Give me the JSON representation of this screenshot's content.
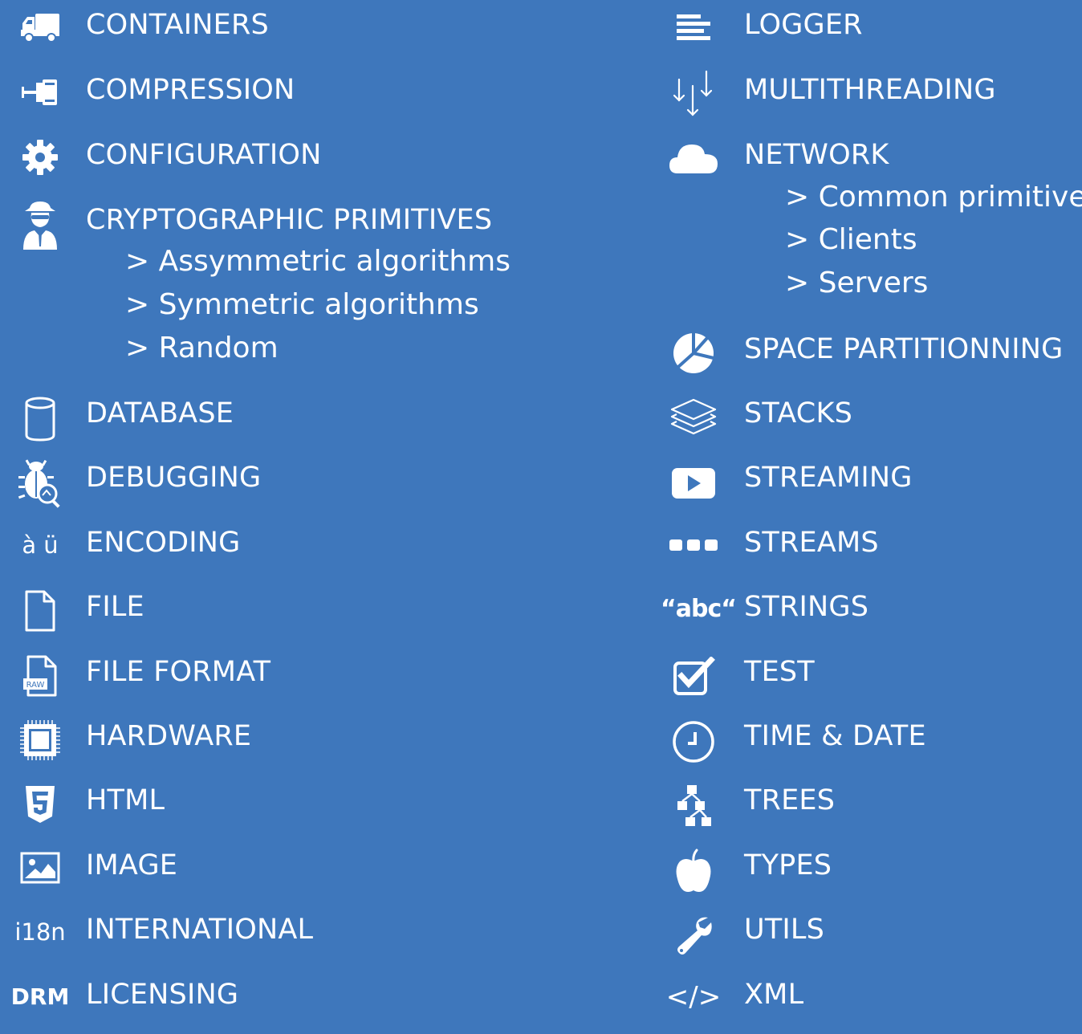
{
  "left": {
    "containers": "CONTAINERS",
    "compression": "COMPRESSION",
    "configuration": "CONFIGURATION",
    "crypto": "CRYPTOGRAPHIC PRIMITIVES",
    "crypto_sub": [
      "> Assymmetric algorithms",
      "> Symmetric algorithms",
      "> Random"
    ],
    "database": "DATABASE",
    "debugging": "DEBUGGING",
    "encoding": "ENCODING",
    "encoding_icon": "à ü",
    "file": "FILE",
    "file_format": "FILE FORMAT",
    "file_format_icon": "RAW",
    "hardware": "HARDWARE",
    "html": "HTML",
    "image": "IMAGE",
    "international": "INTERNATIONAL",
    "international_icon": "i18n",
    "licensing": "LICENSING",
    "licensing_icon": "DRM"
  },
  "right": {
    "logger": "LOGGER",
    "multithreading": "MULTITHREADING",
    "network": "NETWORK",
    "network_sub": [
      "> Common primitives",
      "> Clients",
      "> Servers"
    ],
    "space": "SPACE PARTITIONNING",
    "stacks": "STACKS",
    "streaming": "STREAMING",
    "streams": "STREAMS",
    "strings": "STRINGS",
    "strings_icon": "“abc“",
    "test": "TEST",
    "time": "TIME & DATE",
    "trees": "TREES",
    "types": "TYPES",
    "utils": "UTILS",
    "xml": "XML",
    "xml_icon": "</>"
  },
  "colors": {
    "background": "#3e77bc",
    "foreground": "#ffffff"
  }
}
